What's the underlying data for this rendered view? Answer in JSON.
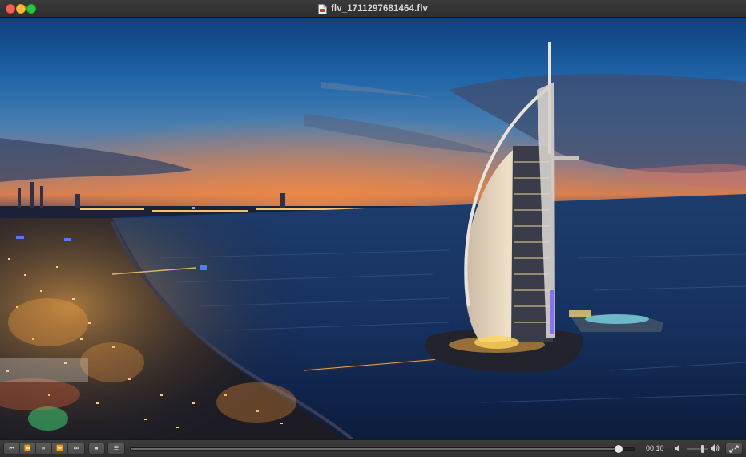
{
  "window": {
    "title": "flv_1711297681464.flv",
    "file_icon": "document-icon"
  },
  "player": {
    "current_time": "00:10",
    "progress_fraction": 0.97,
    "volume_fraction": 0.75,
    "buttons": {
      "skip_back": "⏮",
      "rewind": "⏪",
      "pause": "⏸",
      "fast_forward": "⏩",
      "skip_forward": "⏭",
      "stop": "⏹",
      "playlist": "☰"
    }
  },
  "colors": {
    "close": "#fe5f57",
    "minimize": "#febc2e",
    "maximize": "#28c840"
  }
}
